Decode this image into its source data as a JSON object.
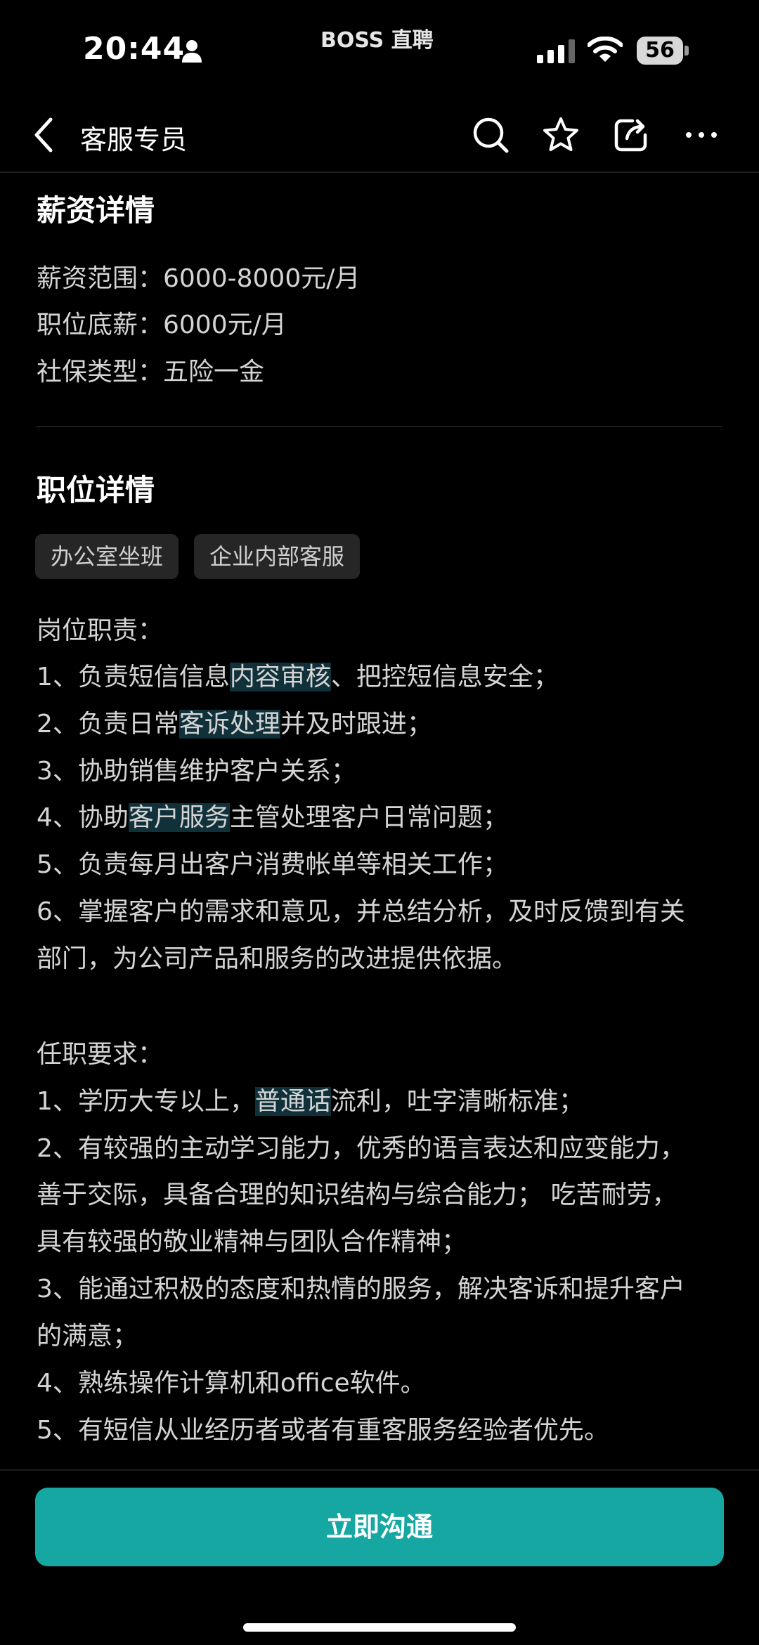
{
  "status_bar": {
    "time": "20:44",
    "carrier": "BOSS 直聘",
    "battery": "56"
  },
  "nav": {
    "title": "客服专员"
  },
  "salary": {
    "heading": "薪资详情",
    "range": "薪资范围：6000-8000元/月",
    "base": "职位底薪：6000元/月",
    "insurance": "社保类型：五险一金"
  },
  "job": {
    "heading": "职位详情",
    "tags": [
      "办公室坐班",
      "企业内部客服"
    ],
    "duties_title": "岗位职责：",
    "duty1": {
      "a": "1、负责短信信息",
      "hl": "内容审核",
      "b": "、把控短信息安全；"
    },
    "duty2": {
      "a": "2、负责日常",
      "hl": "客诉处理",
      "b": "并及时跟进；"
    },
    "duty3": "3、协助销售维护客户关系；",
    "duty4": {
      "a": "4、协助",
      "hl": "客户服务",
      "b": "主管处理客户日常问题；"
    },
    "duty5": "5、负责每月出客户消费帐单等相关工作；",
    "duty6_l1": "6、掌握客户的需求和意见，并总结分析，及时反馈到有关",
    "duty6_l2": "部门，为公司产品和服务的改进提供依据。",
    "req_title": "任职要求：",
    "req1": {
      "a": "1、学历大专以上，",
      "hl": "普通话",
      "b": "流利，吐字清晰标准；"
    },
    "req2_l1": "2、有较强的主动学习能力，优秀的语言表达和应变能力，",
    "req2_l2": "善于交际，具备合理的知识结构与综合能力； 吃苦耐劳，",
    "req2_l3": "具有较强的敬业精神与团队合作精神；",
    "req3_l1": "3、能通过积极的态度和热情的服务，解决客诉和提升客户",
    "req3_l2": "的满意；",
    "req4": "4、熟练操作计算机和office软件。",
    "req5": "5、有短信从业经历者或者有重客服务经验者优先。"
  },
  "cta": {
    "label": "立即沟通"
  },
  "colors": {
    "accent": "#16a7a2",
    "background": "#000000",
    "highlight": "#10313a"
  }
}
